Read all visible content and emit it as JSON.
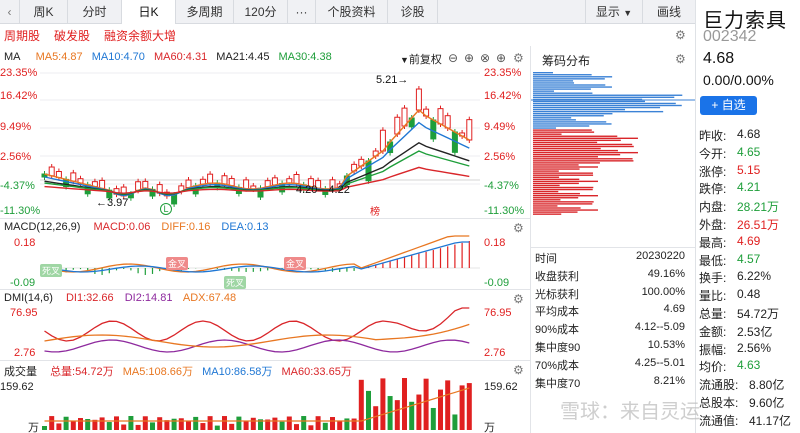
{
  "tabs": {
    "back_icon": "chevron-left-icon",
    "items": [
      "周K",
      "分时",
      "日K",
      "多周期",
      "120分",
      "···",
      "个股资料",
      "诊股"
    ],
    "active": "日K",
    "display": "显示",
    "draw": "画线"
  },
  "subnav": [
    "周期股",
    "破发股",
    "融资余额大增"
  ],
  "price_panel": {
    "indicator": "MA",
    "ma": [
      {
        "label": "MA5:4.87",
        "color": "#e87722"
      },
      {
        "label": "MA10:4.70",
        "color": "#1f77d4"
      },
      {
        "label": "MA60:4.31",
        "color": "#d9262a"
      },
      {
        "label": "MA21:4.45",
        "color": "#222222"
      },
      {
        "label": "MA30:4.38",
        "color": "#1e9e3a"
      }
    ],
    "fuquan": "前复权",
    "y_ticks_left": [
      "23.35%",
      "16.42%",
      "9.49%",
      "2.56%",
      "-4.37%",
      "-11.30%"
    ],
    "y_ticks_right": [
      "23.35%",
      "16.42%",
      "9.49%",
      "2.56%",
      "-4.37%",
      "-11.30%"
    ],
    "high_label": "5.21",
    "low_label": "3.97",
    "range_label": "4.20—4.22",
    "mark_l": "L",
    "mark_bang": "榜"
  },
  "macd_panel": {
    "title": "MACD(12,26,9)",
    "macd": "MACD:0.06",
    "diff": "DIFF:0.16",
    "dea": "DEA:0.13",
    "y_top": "0.18",
    "y_bottom": "-0.09",
    "events": [
      "死叉",
      "金叉",
      "死叉",
      "金叉"
    ]
  },
  "dmi_panel": {
    "title": "DMI(14,6)",
    "di1": "DI1:32.66",
    "di2": "DI2:14.81",
    "adx": "ADX:67.48",
    "y_top": "76.95",
    "y_bottom": "2.76"
  },
  "vol_panel": {
    "title": "成交量",
    "total": "总量:54.72万",
    "ma5": "MA5:108.66万",
    "ma10": "MA10:86.58万",
    "ma60": "MA60:33.65万",
    "y_top": "159.62",
    "y_unit": "万"
  },
  "distribution": {
    "title": "筹码分布",
    "rows": [
      {
        "k": "时间",
        "v": "20230220"
      },
      {
        "k": "收盘获利",
        "v": "49.16%"
      },
      {
        "k": "光标获利",
        "v": "100.00%"
      },
      {
        "k": "平均成本",
        "v": "4.69"
      },
      {
        "k": "90%成本",
        "v": "4.12--5.09"
      },
      {
        "k": "集中度90",
        "v": "10.53%"
      },
      {
        "k": "70%成本",
        "v": "4.25--5.01"
      },
      {
        "k": "集中度70",
        "v": "8.21%"
      }
    ]
  },
  "stock": {
    "name": "巨力索具",
    "code": "002342",
    "price": "4.68",
    "change": "0.00/0.00%",
    "add_label": "+ 自选"
  },
  "quotes": [
    {
      "k": "昨收:",
      "v": "4.68",
      "c": "#222222"
    },
    {
      "k": "今开:",
      "v": "4.65",
      "c": "#1e9e3a"
    },
    {
      "k": "涨停:",
      "v": "5.15",
      "c": "#e02020"
    },
    {
      "k": "跌停:",
      "v": "4.21",
      "c": "#1e9e3a"
    },
    {
      "k": "内盘:",
      "v": "28.21万",
      "c": "#1e9e3a"
    },
    {
      "k": "外盘:",
      "v": "26.51万",
      "c": "#e02020"
    },
    {
      "k": "最高:",
      "v": "4.69",
      "c": "#e02020"
    },
    {
      "k": "最低:",
      "v": "4.57",
      "c": "#1e9e3a"
    },
    {
      "k": "换手:",
      "v": "6.22%",
      "c": "#222222"
    },
    {
      "k": "量比:",
      "v": "0.48",
      "c": "#222222"
    },
    {
      "k": "总量:",
      "v": "54.72万",
      "c": "#222222"
    },
    {
      "k": "金额:",
      "v": "2.53亿",
      "c": "#222222"
    },
    {
      "k": "振幅:",
      "v": "2.56%",
      "c": "#222222"
    },
    {
      "k": "均价:",
      "v": "4.63",
      "c": "#1e9e3a"
    },
    {
      "k": "流通股:",
      "v": "8.80亿",
      "c": "#222222"
    },
    {
      "k": "总股本:",
      "v": "9.60亿",
      "c": "#222222"
    },
    {
      "k": "流通值:",
      "v": "41.17亿",
      "c": "#222222"
    }
  ],
  "watermark": "雪球：来自灵运"
}
